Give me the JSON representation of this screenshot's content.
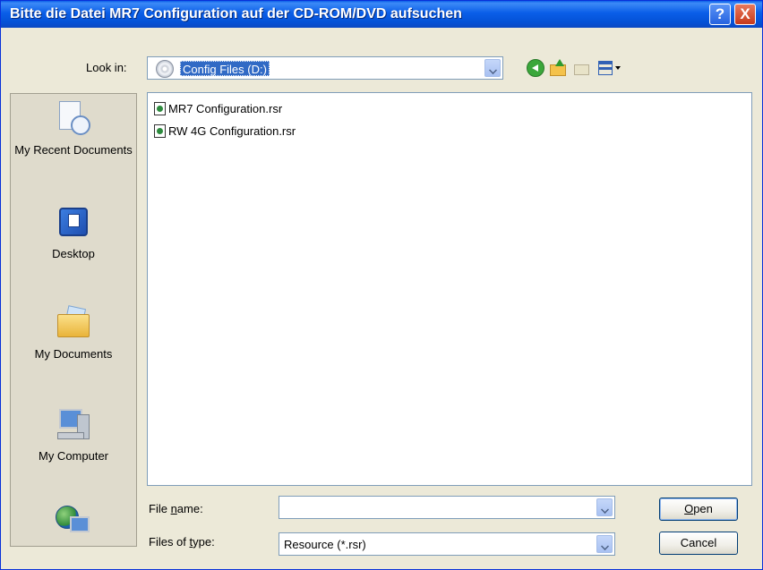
{
  "window": {
    "title": "Bitte die Datei MR7 Configuration auf der CD-ROM/DVD aufsuchen",
    "help_label": "?",
    "close_label": "X"
  },
  "lookin": {
    "label": "Look in:",
    "value": "Config Files (D:)"
  },
  "toolbar": {
    "icons": [
      "back-icon",
      "up-one-level-icon",
      "create-new-folder-icon",
      "views-menu-icon"
    ]
  },
  "places": {
    "items": [
      {
        "label": "My Recent Documents",
        "icon": "recent-documents-icon"
      },
      {
        "label": "Desktop",
        "icon": "desktop-icon"
      },
      {
        "label": "My Documents",
        "icon": "my-documents-icon"
      },
      {
        "label": "My Computer",
        "icon": "my-computer-icon"
      },
      {
        "label": "",
        "icon": "my-network-places-icon"
      }
    ]
  },
  "files": [
    {
      "name": "MR7 Configuration.rsr",
      "icon": "resource-file-icon"
    },
    {
      "name": "RW 4G Configuration.rsr",
      "icon": "resource-file-icon"
    }
  ],
  "filename": {
    "label_pre": "File ",
    "label_key": "n",
    "label_post": "ame:",
    "value": ""
  },
  "filetype": {
    "label_pre": "Files of ",
    "label_key": "t",
    "label_post": "ype:",
    "value": "Resource (*.rsr)"
  },
  "buttons": {
    "open_key": "O",
    "open_rest": "pen",
    "cancel": "Cancel"
  },
  "colors": {
    "titlebar": "#0a5ee8",
    "selection": "#316ac5",
    "dialog_bg": "#ece9d8"
  }
}
